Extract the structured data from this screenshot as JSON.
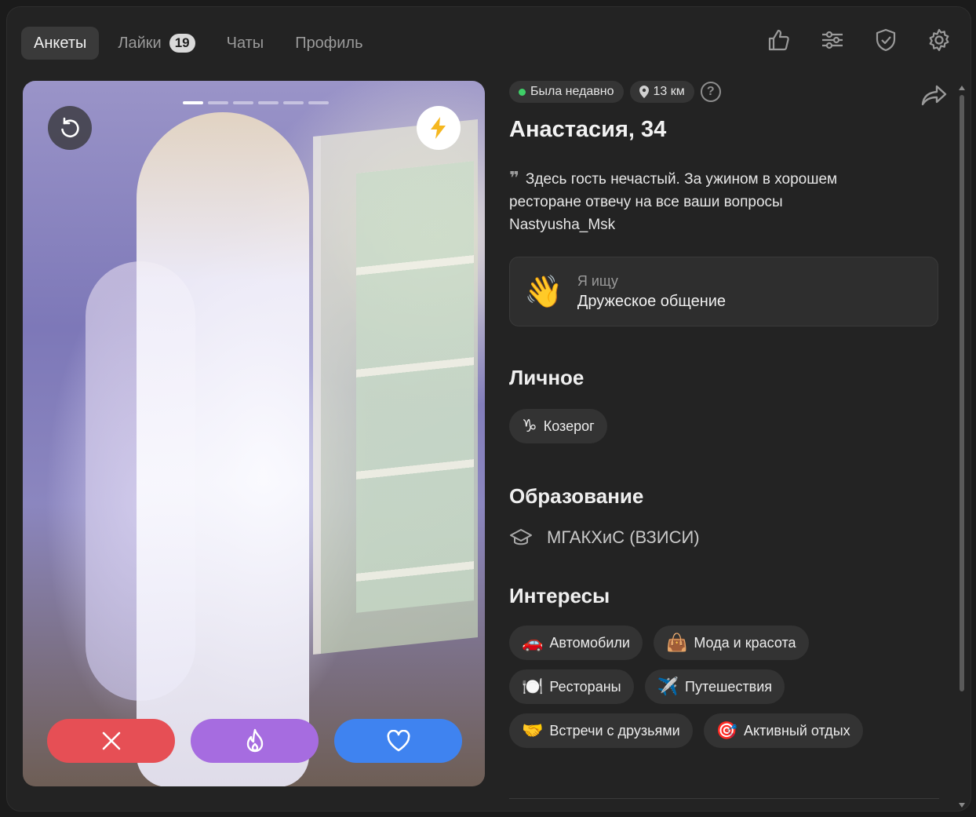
{
  "nav": {
    "tabs": [
      {
        "label": "Анкеты",
        "active": true
      },
      {
        "label": "Лайки",
        "badge": "19"
      },
      {
        "label": "Чаты"
      },
      {
        "label": "Профиль"
      }
    ]
  },
  "top_icons": [
    "thumbs-up-icon",
    "filters-icon",
    "shield-check-icon",
    "gear-icon"
  ],
  "photo": {
    "total_photos": 6,
    "current_photo": 1,
    "action_colors": {
      "dislike": "#e64f55",
      "superlike": "#a66ce0",
      "like": "#3f83f0"
    }
  },
  "profile": {
    "status": "Была недавно",
    "distance": "13 км",
    "help": "?",
    "name": "Анастасия, 34",
    "bio": "Здесь гость нечастый. За ужином в хорошем ресторане отвечу на все ваши вопросы Nastyusha_Msk",
    "looking_label": "Я ищу",
    "looking_value": "Дружеское общение",
    "looking_emoji": "👋"
  },
  "sections": {
    "personal_title": "Личное",
    "personal": [
      {
        "icon": "♑",
        "label": "Козерог"
      }
    ],
    "education_title": "Образование",
    "education": "МГАКХиС (ВЗИСИ)",
    "interests_title": "Интересы",
    "interests": [
      {
        "icon": "🚗",
        "label": "Автомобили"
      },
      {
        "icon": "👜",
        "label": "Мода и красота"
      },
      {
        "icon": "🍽️",
        "label": "Рестораны"
      },
      {
        "icon": "✈️",
        "label": "Путешествия"
      },
      {
        "icon": "🤝",
        "label": "Встречи с друзьями"
      },
      {
        "icon": "🎯",
        "label": "Активный отдых"
      }
    ]
  }
}
